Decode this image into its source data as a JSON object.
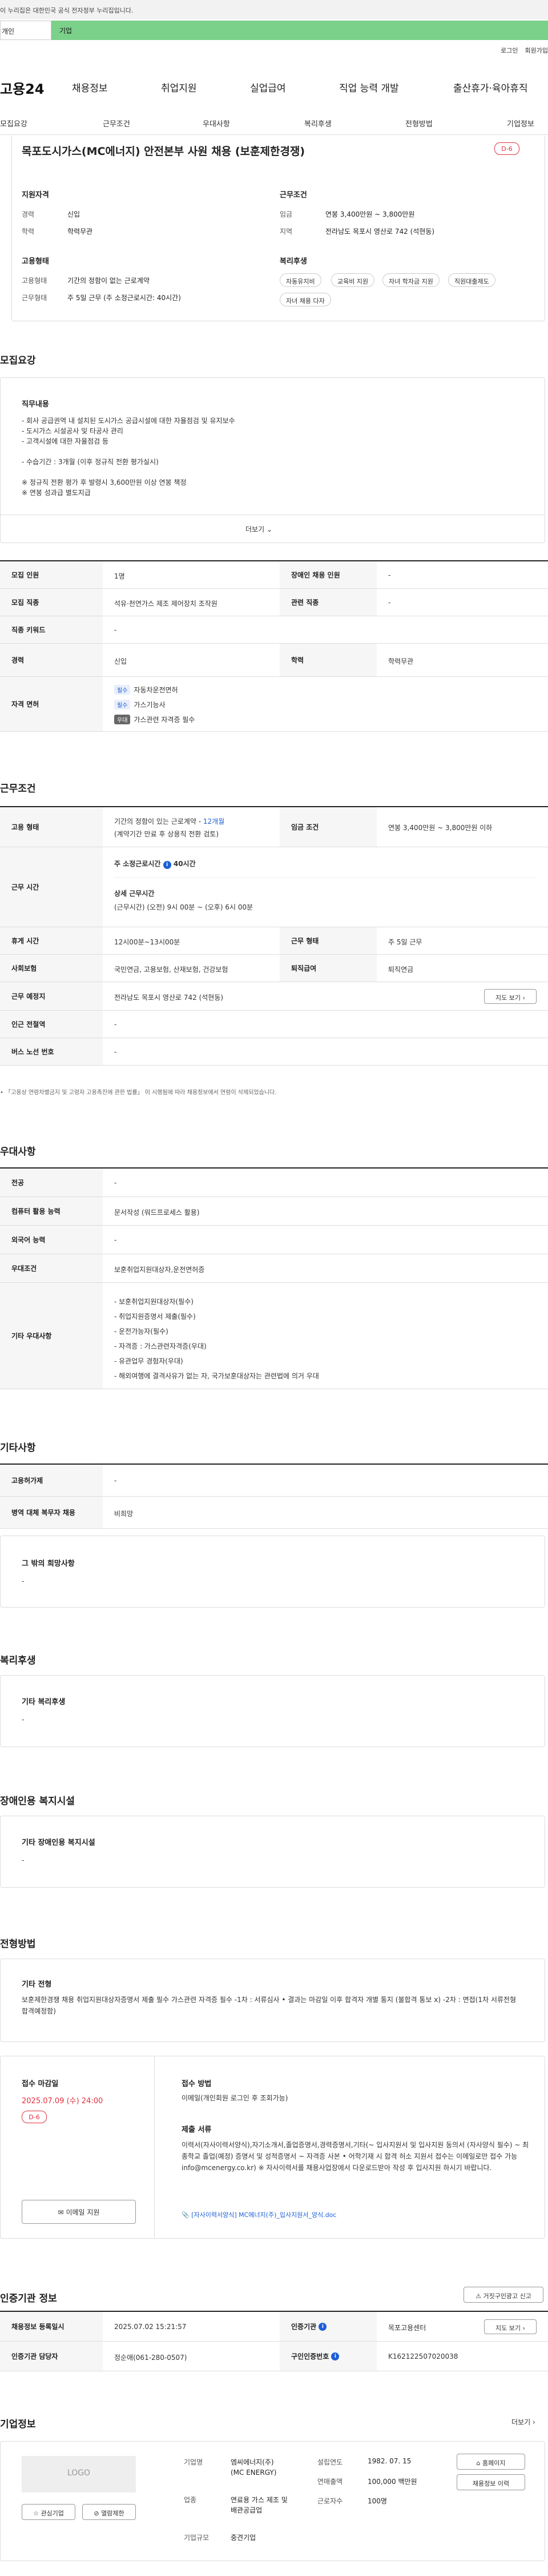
{
  "gov_banner": "이 누리집은 대한민국 공식 전자정부 누리집입니다.",
  "tabs": {
    "individual": "개인",
    "business": "기업"
  },
  "util": {
    "login": "로그인",
    "join": "회원가입"
  },
  "gnb": {
    "logo": "고용24",
    "menus": [
      "채용정보",
      "취업지원",
      "실업급여",
      "직업 능력 개발",
      "출산휴가·육아휴직"
    ]
  },
  "snb": [
    "모집요강",
    "근무조건",
    "우대사항",
    "복리후생",
    "전형방법",
    "기업정보"
  ],
  "job": {
    "title": "목포도시가스(MC에너지) 안전본부 사원 채용 (보훈제한경쟁)",
    "dday": "D-6",
    "qual_head": "지원자격",
    "career_label": "경력",
    "career_value": "신입",
    "edu_label": "학력",
    "edu_value": "학력무관",
    "emp_head": "고용형태",
    "emp_type_label": "고용형태",
    "emp_type_value": "기간의 정함이 없는 근로계약",
    "work_type_label": "근무형태",
    "work_type_value": "주 5일 근무 (주 소정근로시간: 40시간)",
    "cond_head": "근무조건",
    "wage_label": "임금",
    "wage_value": "연봉 3,400만원 ~ 3,800만원",
    "place_label": "지역",
    "place_value": "전라남도 목포시 영산로 742 (석현동)",
    "welfare_head": "복리후생",
    "welfare_chips": [
      "자동유지비",
      "교육비 지원",
      "자녀 학자금 지원",
      "직원대출제도",
      "자녀 채용 다자"
    ]
  },
  "recruit": {
    "title": "모집요강",
    "duty_head": "직무내용",
    "duty_lines": [
      "- 회사 공급권역 내 설치된 도시가스 공급시설에 대한 자율점검 및 유지보수",
      "- 도시가스 시설공사 및 타공사 관리",
      "- 고객시설에 대한 자율점검 등",
      "",
      "- 수습기간 : 3개월 (이후 정규직 전환 평가실시)",
      "",
      "※ 정규직 전환 평가 후 발령시 3,600만원 이상 연봉 책정",
      "※ 연봉 성과급 별도지급"
    ],
    "more": "더보기",
    "rows": [
      {
        "l1": "모집 인원",
        "v1": "1명",
        "l2": "장애인 채용 인원",
        "v2": "-"
      },
      {
        "l1": "모집 직종",
        "v1": "석유·천연가스 제조 제어장치 조작원",
        "l2": "관련 직종",
        "v2": "-"
      },
      {
        "l1": "직종 키워드",
        "v1": "-",
        "l2": "",
        "v2": ""
      },
      {
        "l1": "경력",
        "v1": "신입",
        "l2": "학력",
        "v2": "학력무관"
      }
    ],
    "license_label": "자격 면허",
    "licenses": [
      {
        "tag": "필수",
        "name": "자동차운전면허"
      },
      {
        "tag": "필수",
        "name": "가스기능사"
      },
      {
        "tag": "우대",
        "name": "가스관련 자격증 필수"
      }
    ]
  },
  "conditions": {
    "title": "근무조건",
    "emp_label": "고용 형태",
    "emp_value": "기간의 정함이 있는 근로계약 - ",
    "emp_value_hl": "12개월",
    "emp_note": "(계약기간 만료 후 상용직 전환 검토)",
    "wage_label": "임금 조건",
    "wage_value": "연봉 3,400만원 ~ 3,800만원 이하",
    "time_label": "근무 시간",
    "time_weekly": "주 소정근로시간",
    "time_weekly_val": "40시간",
    "time_detail_head": "상세 근무시간",
    "time_detail": "(근무시간) (오전) 9시 00분 ~ (오후) 6시 00분",
    "rest_label": "휴게 시간",
    "rest_value": "12시00분~13시00분",
    "shift_label": "근무 형태",
    "shift_value": "주 5일 근무",
    "ins_label": "사회보험",
    "ins_value": "국민연금, 고용보험, 산재보험, 건강보험",
    "retire_label": "퇴직급여",
    "retire_value": "퇴직연금",
    "addr_label": "근무 예정지",
    "addr_value": "전라남도 목포시 영산로 742 (석현동)",
    "map_btn": "지도 보기",
    "station_label": "인근 전철역",
    "station_value": "-",
    "bus_label": "버스 노선 번호",
    "bus_value": "-",
    "footnote": "「고용상 연령차별금지 및 고령자 고용촉진에 관한 법률」 이 시행됨에 따라 채용정보에서 연령이 삭제되었습니다."
  },
  "prefer": {
    "title": "우대사항",
    "rows": [
      {
        "label": "전공",
        "value": "-"
      },
      {
        "label": "컴퓨터 활용 능력",
        "value": "문서작성 (워드프로세스 활용)"
      },
      {
        "label": "외국어 능력",
        "value": "-"
      },
      {
        "label": "우대조건",
        "value": "보훈취업지원대상자,운전면허증"
      }
    ],
    "other_label": "기타 우대사항",
    "other_lines": [
      "- 보훈취업지원대상자(필수)",
      "- 취업지원증명서 제출(필수)",
      "- 운전가능자(필수)",
      "- 자격증 : 가스관련자격증(우대)",
      "- 유관업무 경험자(우대)",
      "- 해외여행에 결격사유가 없는 자, 국가보훈대상자는 관련법에 의거 우대"
    ]
  },
  "etc": {
    "title": "기타사항",
    "rows": [
      {
        "label": "고용허가제",
        "value": "-"
      },
      {
        "label": "병역 대체 복무자 채용",
        "value": "비희망"
      }
    ],
    "other_head": "그 밖의 희망사항",
    "other_value": "-"
  },
  "welfare": {
    "title": "복리후생",
    "head": "기타 복리후생",
    "value": "-"
  },
  "disabled": {
    "title": "장애인용 복지시설",
    "head": "기타 장애인용 복지시설",
    "value": "-"
  },
  "process": {
    "title": "전형방법",
    "head": "기타 전형",
    "text": "보훈제한경쟁 채용 취업지원대상자증명서 제출 필수 가스관련 자격증 필수 -1차 : 서류심사 • 결과는 마감일 이후 합격자 개별 통지 (불합격 통보 x) -2차 : 면접(1차 서류전형 합격예정함)",
    "deadline_head": "접수 마감일",
    "deadline_value": "2025.07.09 (수) 24:00",
    "dday": "D-6",
    "email_btn": "이메일 지원",
    "method_head": "접수 방법",
    "method_value": "이메일(개인회원 로그인 후 조회가능)",
    "docs_head": "제출 서류",
    "docs_text": "이력서(자사이력서양식),자기소개서,졸업증명서,경력증명서,기타(~ 입사지원서 및 입사지원 동의서 (자사양식 필수) ~ 최종학교 졸업(예정) 증명서 및 성적증명서 ~ 자격증 사본 • 어학기재 시 합격 허소 지원서 접수는 이메일로만 접수 가능 info@mcenergy.co.kr) ※ 자사이력서를 채용사업장에서 다운로드받아 작성 후 입사지원 하시기 바랍니다.",
    "file_name": "[자사이력서양식] MC에너지(주)_입사지원서_양식.doc"
  },
  "cert": {
    "title": "인증기관 정보",
    "report_btn": "거짓구인광고 신고",
    "rows": [
      {
        "l1": "채용정보 등록일시",
        "v1": "2025.07.02 15:21:57",
        "l2": "인증기관",
        "v2": "목포고용센터"
      },
      {
        "l1": "인증기관 담당자",
        "v1": "정순애(061-280-0507)",
        "l2": "구인인증번호",
        "v2": "K162122507020038"
      }
    ],
    "map_btn": "지도 보기"
  },
  "company": {
    "title": "기업정보",
    "more": "더보기",
    "logo": "LOGO",
    "interest_btn": "관심기업",
    "block_btn": "열람제한",
    "name_label": "기업명",
    "name_value": "엠씨에너지(주)\n(MC ENERGY)",
    "industry_label": "업종",
    "industry_value": "연료용 가스 제조 및 배관공급업",
    "size_label": "기업규모",
    "size_value": "중견기업",
    "found_label": "설립연도",
    "found_value": "1982. 07. 15",
    "sales_label": "연매출액",
    "sales_value": "100,000 백만원",
    "emp_label": "근로자수",
    "emp_value": "100명",
    "homepage_btn": "홈페이지",
    "jobs_btn": "채용정보 이력"
  }
}
